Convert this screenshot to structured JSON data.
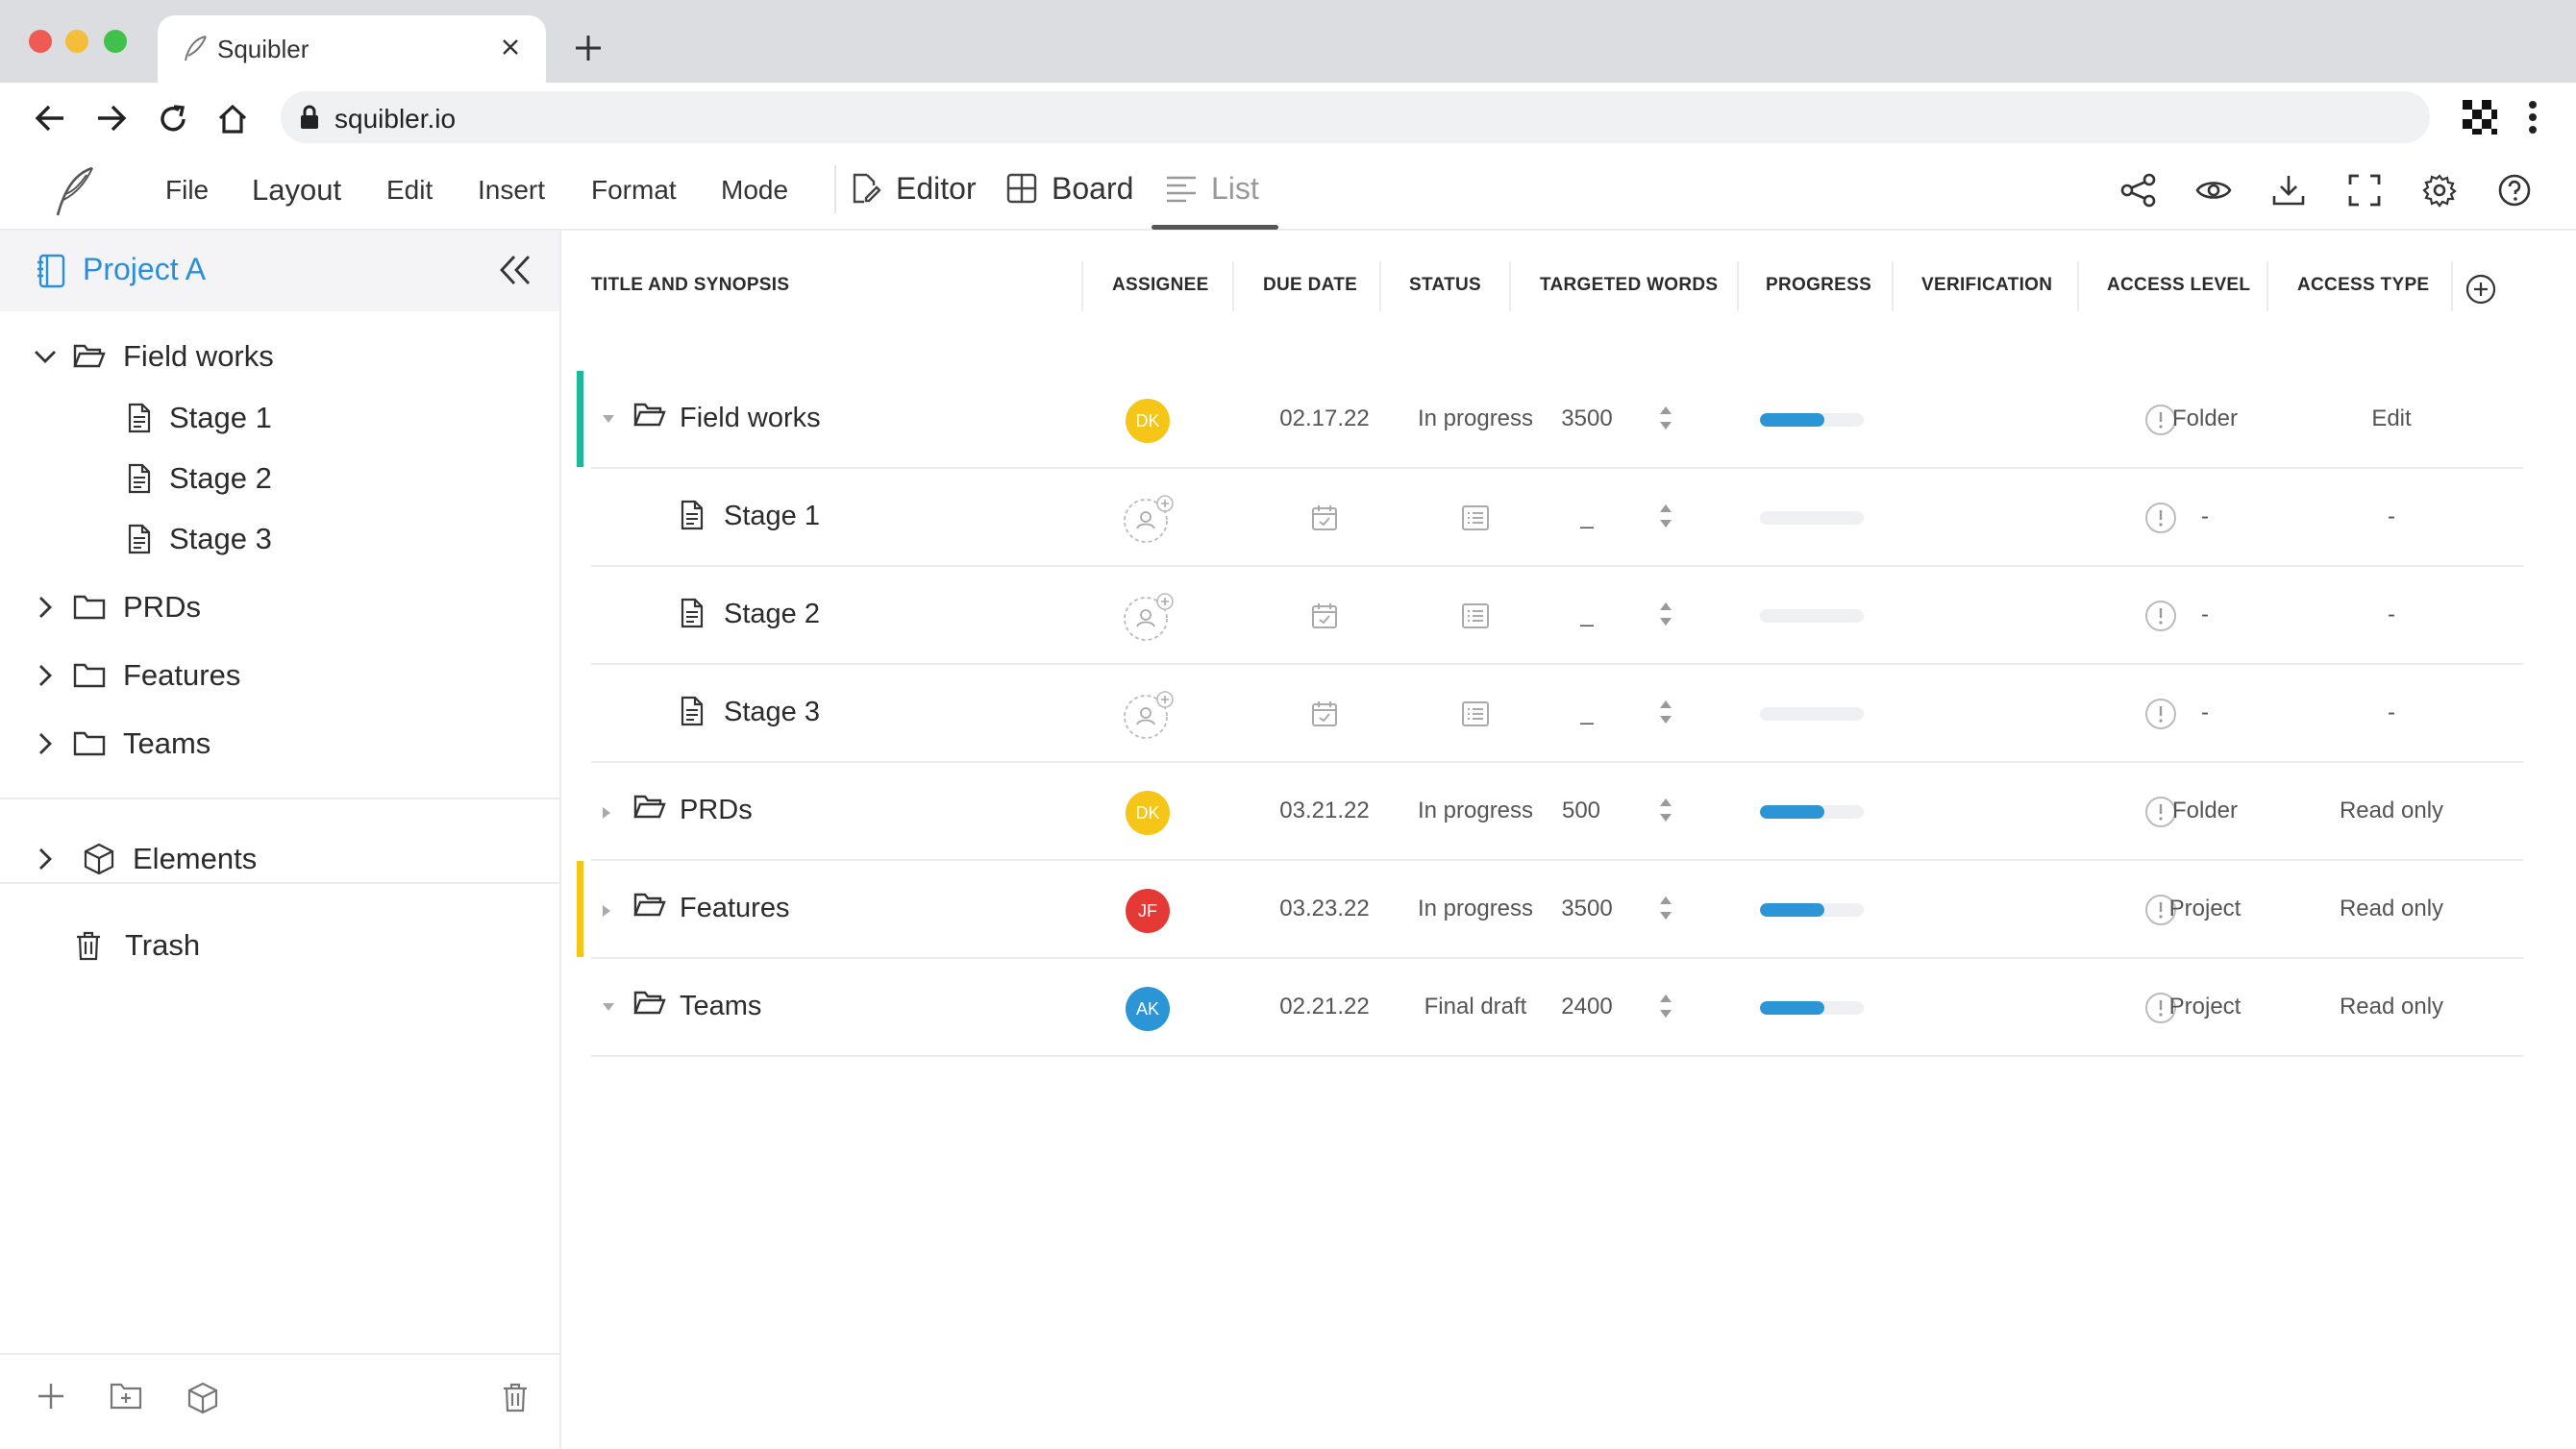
{
  "browser": {
    "tab_title": "Squibler",
    "url": "squibler.io"
  },
  "menu": [
    "File",
    "Layout",
    "Edit",
    "Insert",
    "Format",
    "Mode"
  ],
  "views": {
    "editor": "Editor",
    "board": "Board",
    "list": "List",
    "active": "List"
  },
  "sidebar": {
    "project": "Project A",
    "tree": [
      {
        "label": "Field works",
        "expanded": true,
        "children": [
          "Stage 1",
          "Stage 2",
          "Stage 3"
        ]
      },
      {
        "label": "PRDs",
        "expanded": false
      },
      {
        "label": "Features",
        "expanded": false
      },
      {
        "label": "Teams",
        "expanded": false
      }
    ],
    "elements": "Elements",
    "trash": "Trash"
  },
  "table": {
    "columns": [
      "TITLE AND SYNOPSIS",
      "ASSIGNEE",
      "DUE DATE",
      "STATUS",
      "TARGETED WORDS",
      "PROGRESS",
      "VERIFICATION",
      "ACCESS LEVEL",
      "ACCESS TYPE"
    ],
    "rows": [
      {
        "title": "Field works",
        "type": "folder",
        "assignee": "DK",
        "due": "02.17.22",
        "status": "In progress",
        "words": "3500",
        "progress": 0.62,
        "level": "Folder",
        "access": "Edit"
      },
      {
        "title": "Stage 1",
        "type": "doc",
        "assignee": "",
        "due": "",
        "status": "",
        "words": "_",
        "progress": 0,
        "level": "-",
        "access": "-"
      },
      {
        "title": "Stage 2",
        "type": "doc",
        "assignee": "",
        "due": "",
        "status": "",
        "words": "_",
        "progress": 0,
        "level": "-",
        "access": "-"
      },
      {
        "title": "Stage 3",
        "type": "doc",
        "assignee": "",
        "due": "",
        "status": "",
        "words": "_",
        "progress": 0,
        "level": "-",
        "access": "-"
      },
      {
        "title": "PRDs",
        "type": "folder",
        "assignee": "DK",
        "due": "03.21.22",
        "status": "In progress",
        "words": "500",
        "progress": 0.62,
        "level": "Folder",
        "access": "Read only"
      },
      {
        "title": "Features",
        "type": "folder",
        "assignee": "JF",
        "due": "03.23.22",
        "status": "In progress",
        "words": "3500",
        "progress": 0.62,
        "level": "Project",
        "access": "Read only"
      },
      {
        "title": "Teams",
        "type": "folder",
        "assignee": "AK",
        "due": "02.21.22",
        "status": "Final draft",
        "words": "2400",
        "progress": 0.62,
        "level": "Project",
        "access": "Read only"
      }
    ]
  },
  "colors": {
    "accent_blue": "#2b8ed8",
    "progress": "#2b95d6",
    "avatar_dk": "#f5c518",
    "avatar_jf": "#e53935",
    "avatar_ak": "#2b95d6",
    "accent_green": "#1fb89a",
    "accent_yellow": "#f5c518"
  }
}
